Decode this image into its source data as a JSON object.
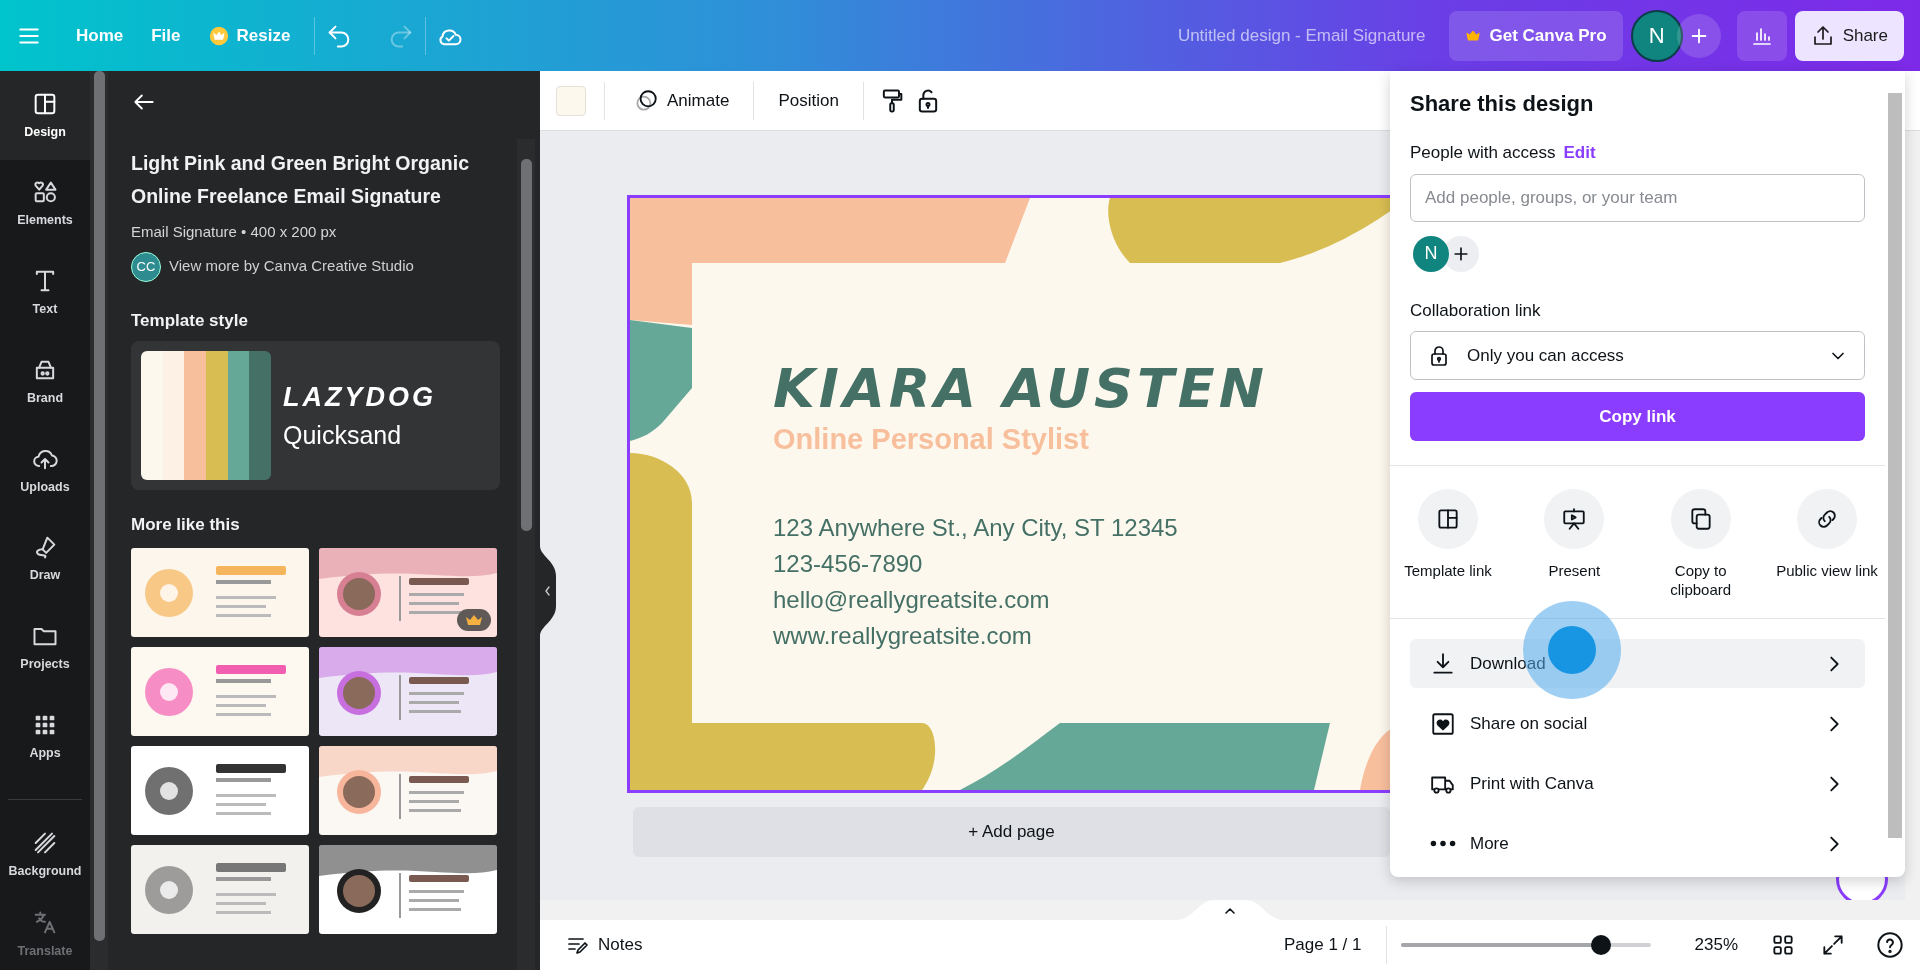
{
  "topbar": {
    "menu": [
      {
        "label": "Home",
        "premium": false
      },
      {
        "label": "File",
        "premium": false
      },
      {
        "label": "Resize",
        "premium": true
      }
    ],
    "redo": {
      "disabled": true
    },
    "title": "Untitled design - Email Signature",
    "pro_button": "Get Canva Pro",
    "avatar": "N",
    "share": {
      "label": "Share",
      "open": true
    }
  },
  "rail": [
    {
      "label": "Design",
      "selected": true
    },
    {
      "label": "Elements",
      "selected": false
    },
    {
      "label": "Text",
      "selected": false
    },
    {
      "label": "Brand",
      "selected": false
    },
    {
      "label": "Uploads",
      "selected": false
    },
    {
      "label": "Draw",
      "selected": false
    },
    {
      "label": "Projects",
      "selected": false
    },
    {
      "label": "Apps",
      "selected": false
    },
    {
      "label": "Background",
      "selected": false
    },
    {
      "label": "Translate",
      "selected": false
    }
  ],
  "panel": {
    "title": "Light Pink and Green Bright Organic Online Freelance Email Signature",
    "meta": "Email Signature • 400 x 200 px",
    "author_avatar": "CC",
    "author_link": "View more by Canva Creative Studio",
    "style_heading": "Template style",
    "palette": [
      {
        "color": "#fdf8ee"
      },
      {
        "color": "#fdf0e4"
      },
      {
        "color": "#f8bf9d"
      },
      {
        "color": "#d8bd52"
      },
      {
        "color": "#66a898"
      },
      {
        "color": "#457066"
      }
    ],
    "fonts": [
      "LAZYDOG",
      "Quicksand"
    ],
    "more_heading": "More like this",
    "thumbnails": [
      {
        "kind": "picture",
        "premium": false
      },
      {
        "kind": "picture",
        "premium": true
      },
      {
        "kind": "picture",
        "premium": false
      },
      {
        "kind": "picture",
        "premium": false
      },
      {
        "kind": "picture",
        "premium": false
      },
      {
        "kind": "picture",
        "premium": false
      },
      {
        "kind": "picture",
        "premium": false
      },
      {
        "kind": "picture",
        "premium": false
      }
    ]
  },
  "toolbar": {
    "buttons": [
      "Animate",
      "Position"
    ]
  },
  "design": {
    "name": "KIARA AUSTEN",
    "role": "Online Personal Stylist",
    "lines": [
      "123 Anywhere St., Any City, ST 12345",
      "123-456-7890",
      "hello@reallygreatsite.com",
      "www.reallygreatsite.com"
    ]
  },
  "add_page": "+ Add page",
  "share_panel": {
    "title": "Share this design",
    "access_label": "People with access",
    "edit_link": "Edit",
    "placeholder": "Add people, groups, or your team",
    "people": [
      "N"
    ],
    "collab_label": "Collaboration link",
    "access_option": "Only you can access",
    "copy_button": "Copy link",
    "actions": [
      {
        "label": "Template link"
      },
      {
        "label": "Present"
      },
      {
        "label": "Copy to clipboard"
      },
      {
        "label": "Public view link"
      }
    ],
    "menu": [
      {
        "label": "Download",
        "selected": true
      },
      {
        "label": "Share on social",
        "selected": false
      },
      {
        "label": "Print with Canva",
        "selected": false
      },
      {
        "label": "More",
        "selected": false
      }
    ]
  },
  "bottombar": {
    "notes": "Notes",
    "page": "Page 1 / 1",
    "zoom": {
      "level": 0.8
    },
    "zoom_reading": "235%"
  }
}
